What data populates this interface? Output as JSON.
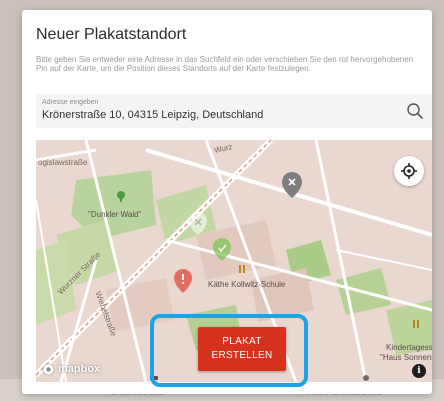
{
  "modal": {
    "title": "Neuer Plakatstandort",
    "description": "Bitte geben Sie entweder eine Adresse in das Suchfeld ein oder verschieben Sie den rot hervorgehobenen Pin auf der Karte, um die Position dieses Standorts auf der Karte festzulegen."
  },
  "address": {
    "label": "Adresse eingeben",
    "value": "Krönerstraße 10, 04315 Leipzig, Deutschland",
    "search_icon": "search-icon"
  },
  "map": {
    "streets": {
      "top_left": "ogislawstraße",
      "wurzner": "Wurzner Straße",
      "wiebel": "Wiebelstraße",
      "top_wurz": "Wurz"
    },
    "places": {
      "dunkler_wald": "\"Dunkler Wald\"",
      "kaethe": "Käthe Kollwitz-Schule",
      "kita_line1": "Kindertagesstätte",
      "kita_line2": "\"Haus Sonnenblume\""
    },
    "locate_icon": "crosshair-icon",
    "info_label": "i",
    "logo_text": "mapbox",
    "pin_colors": {
      "gray": "#7d7d7d",
      "green": "#7fc55a",
      "red": "#e05248"
    }
  },
  "create_button": {
    "line1": "PLAKAT",
    "line2": "ERSTELLEN",
    "color": "#d6331f",
    "highlight_color": "#1aa3e6"
  },
  "background": {
    "left_text": "Pendorffstraße",
    "right_text": "Pinkert-Grundschule"
  }
}
